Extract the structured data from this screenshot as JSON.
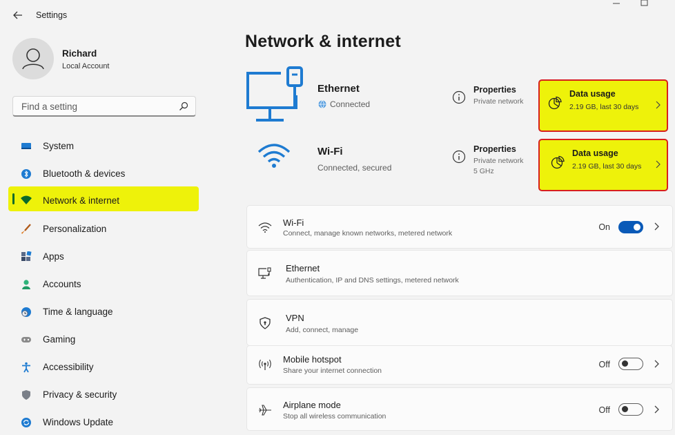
{
  "window": {
    "title": "Settings"
  },
  "profile": {
    "name": "Richard",
    "account_type": "Local Account"
  },
  "search": {
    "placeholder": "Find a setting"
  },
  "sidebar": {
    "items": [
      {
        "label": "System",
        "icon": "system-icon"
      },
      {
        "label": "Bluetooth & devices",
        "icon": "bluetooth-icon"
      },
      {
        "label": "Network & internet",
        "icon": "network-icon",
        "selected": true
      },
      {
        "label": "Personalization",
        "icon": "brush-icon"
      },
      {
        "label": "Apps",
        "icon": "apps-icon"
      },
      {
        "label": "Accounts",
        "icon": "accounts-icon"
      },
      {
        "label": "Time & language",
        "icon": "clock-globe-icon"
      },
      {
        "label": "Gaming",
        "icon": "gamepad-icon"
      },
      {
        "label": "Accessibility",
        "icon": "accessibility-icon"
      },
      {
        "label": "Privacy & security",
        "icon": "shield-icon"
      },
      {
        "label": "Windows Update",
        "icon": "update-icon"
      }
    ]
  },
  "page": {
    "title": "Network & internet"
  },
  "connections": {
    "ethernet": {
      "name": "Ethernet",
      "status": "Connected",
      "properties": {
        "title": "Properties",
        "lines": [
          "Private network"
        ]
      },
      "data_usage": {
        "title": "Data usage",
        "detail": "2.19 GB, last 30 days"
      }
    },
    "wifi": {
      "name": "Wi-Fi",
      "status": "Connected, secured",
      "properties": {
        "title": "Properties",
        "lines": [
          "Private network",
          "5 GHz"
        ]
      },
      "data_usage": {
        "title": "Data usage",
        "detail": "2.19 GB, last 30 days"
      }
    }
  },
  "settings_cards": [
    {
      "title": "Wi-Fi",
      "subtitle": "Connect, manage known networks, metered network",
      "toggle_label": "On",
      "toggle_on": true
    },
    {
      "title": "Ethernet",
      "subtitle": "Authentication, IP and DNS settings, metered network"
    },
    {
      "title": "VPN",
      "subtitle": "Add, connect, manage"
    },
    {
      "title": "Mobile hotspot",
      "subtitle": "Share your internet connection",
      "toggle_label": "Off",
      "toggle_on": false
    },
    {
      "title": "Airplane mode",
      "subtitle": "Stop all wireless communication",
      "toggle_label": "Off",
      "toggle_on": false
    }
  ],
  "colors": {
    "accent": "#0a5ab8",
    "highlight": "#eef20a",
    "highlight_border": "#d81e1e",
    "selected_indicator": "#0a6a2a"
  }
}
